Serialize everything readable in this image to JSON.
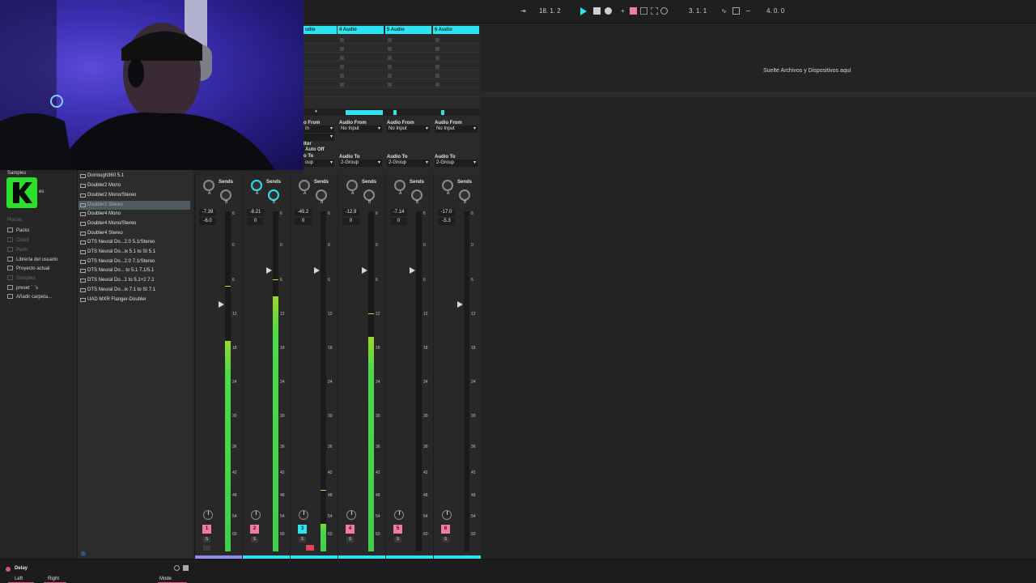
{
  "transport": {
    "position": "18. 1. 2",
    "loop_start": "3. 1. 1",
    "loop_length": "4. 0. 0"
  },
  "session": {
    "tracks": [
      {
        "header": "udio"
      },
      {
        "header": "4 Audio"
      },
      {
        "header": "5 Audio"
      },
      {
        "header": "6 Audio"
      }
    ],
    "io": {
      "partial_from": "o From",
      "partial_in": "In",
      "partial_monitor": "itor",
      "auto": "Auto",
      "off": "Off",
      "partial_to": "o To",
      "partial_group": "oup",
      "audio_from": "Audio From",
      "no_input": "No Input",
      "audio_to": "Audio To",
      "group": "2-Group"
    }
  },
  "drop_zone": {
    "text": "Suelte Archivos y Dispositivos aquí"
  },
  "browser": {
    "sidebar": {
      "samples_top": "Samples",
      "partial": "es",
      "places_heading": "Places",
      "items": [
        {
          "label": "Packs",
          "dim": false
        },
        {
          "label": "Cloud",
          "dim": true
        },
        {
          "label": "Push",
          "dim": true
        },
        {
          "label": "Librería del usuario",
          "dim": false
        },
        {
          "label": "Proyecto actual",
          "dim": false
        },
        {
          "label": "Samples",
          "dim": true
        },
        {
          "label": "preset ` `s",
          "dim": false
        },
        {
          "label": "Añadir carpeta...",
          "dim": false
        }
      ]
    },
    "list": [
      {
        "label": "Dorrough360 5.1",
        "selected": false
      },
      {
        "label": "Doubler2 Mono",
        "selected": false
      },
      {
        "label": "Doubler2 Mono/Stereo",
        "selected": false
      },
      {
        "label": "Doubler2 Stereo",
        "selected": true
      },
      {
        "label": "Doubler4 Mono",
        "selected": false
      },
      {
        "label": "Doubler4 Mono/Stereo",
        "selected": false
      },
      {
        "label": "Doubler4 Stereo",
        "selected": false
      },
      {
        "label": "DTS Neural Do...2.0 5.1/Stereo",
        "selected": false
      },
      {
        "label": "DTS Neural Do...ix 5.1 to St 5.1",
        "selected": false
      },
      {
        "label": "DTS Neural Do...2.0 7.1/Stereo",
        "selected": false
      },
      {
        "label": "DTS Neural Do... to 5.1 7.1/5.1",
        "selected": false
      },
      {
        "label": "DTS Neural Do...1 to 5.1+2 7.1",
        "selected": false
      },
      {
        "label": "DTS Neural Do...ix 7.1 to St 7.1",
        "selected": false
      },
      {
        "label": "UAD MXR Flanger-Doubler",
        "selected": false
      }
    ]
  },
  "mixer": {
    "sends_label": "Sends",
    "send_a": "A",
    "send_b": "B",
    "solo": "S",
    "scale": [
      "6",
      "0",
      "6",
      "12",
      "18",
      "24",
      "30",
      "36",
      "42",
      "48",
      "54",
      "60"
    ],
    "channels": [
      {
        "number": "1",
        "volume": "-7.39",
        "pan": "-6.0",
        "meter": 0.62,
        "peak": 0.78,
        "fader": 0.83,
        "selected": false
      },
      {
        "number": "2",
        "volume": "-8.21",
        "pan": "0",
        "meter": 0.75,
        "peak": 0.8,
        "fader": 0.93,
        "selected": false
      },
      {
        "number": "3",
        "volume": "-45.2",
        "pan": "0",
        "meter": 0.08,
        "peak": 0.18,
        "fader": 0.93,
        "selected": true
      },
      {
        "number": "4",
        "volume": "-12.9",
        "pan": "0",
        "meter": 0.63,
        "peak": 0.7,
        "fader": 0.93,
        "selected": false
      },
      {
        "number": "5",
        "volume": "-7.14",
        "pan": "0",
        "meter": 0.0,
        "peak": 0.0,
        "fader": 0.93,
        "selected": false
      },
      {
        "number": "6",
        "volume": "-17.0",
        "pan": "-5.3",
        "meter": 0.0,
        "peak": 0.0,
        "fader": 0.83,
        "selected": false
      }
    ]
  },
  "device": {
    "name": "Delay",
    "left": "Left",
    "right": "Right",
    "mode": "Mode"
  },
  "colors": {
    "accent_cyan": "#2de3f0",
    "track_pink": "#f07aa8",
    "meter_green": "#3ecf47",
    "arm_red": "#e0445a"
  }
}
